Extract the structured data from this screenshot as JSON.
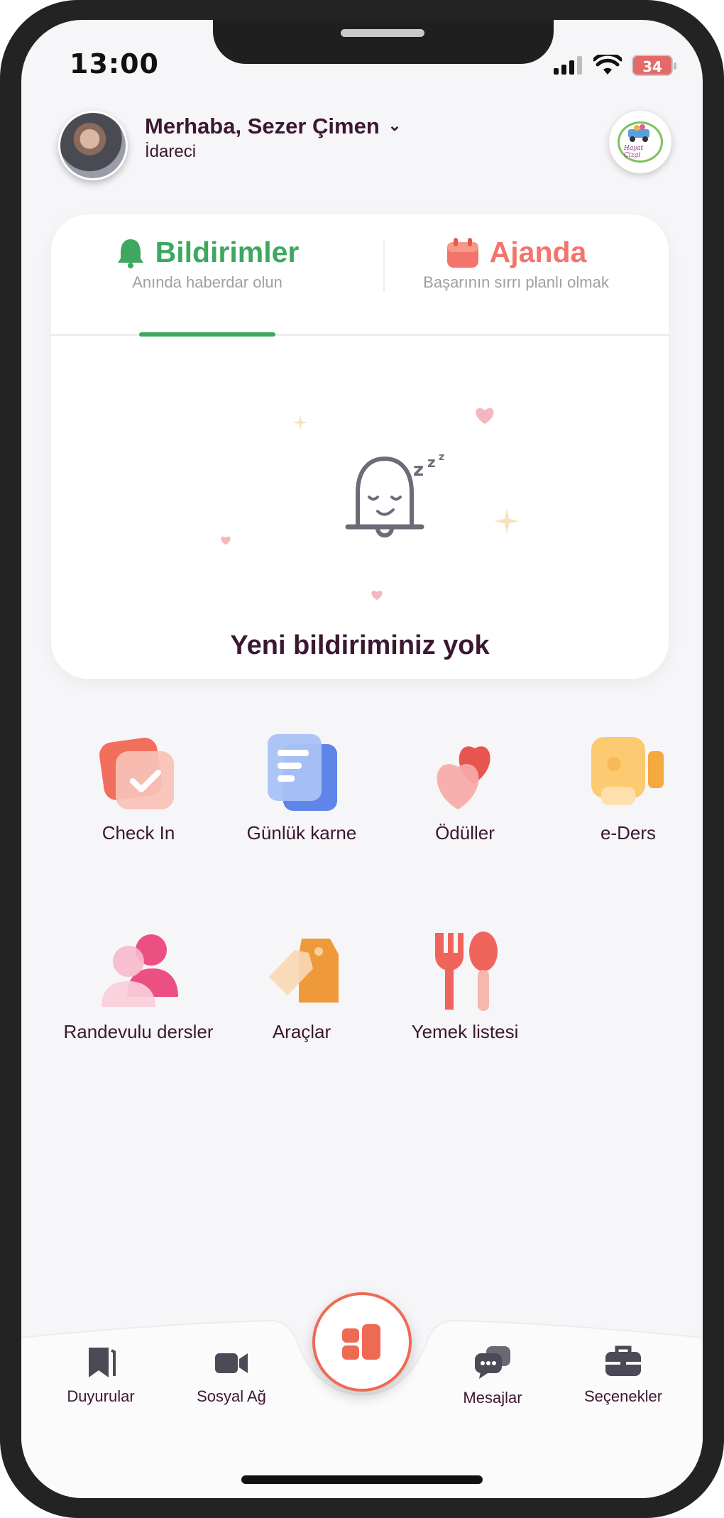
{
  "status_bar": {
    "time": "13:00",
    "battery": "34"
  },
  "header": {
    "greeting": "Merhaba, Sezer Çimen",
    "role": "İdareci",
    "school_logo_text": "Hayat Çizgi"
  },
  "tabs": [
    {
      "title": "Bildirimler",
      "subtitle": "Anında haberdar olun",
      "active": true,
      "color": "#3ea760"
    },
    {
      "title": "Ajanda",
      "subtitle": "Başarının sırrı planlı olmak",
      "active": false,
      "color": "#f2746b"
    }
  ],
  "empty_state": {
    "message": "Yeni bildiriminiz yok"
  },
  "menu": [
    {
      "label": "Check In",
      "icon": "check-in-icon"
    },
    {
      "label": "Günlük karne",
      "icon": "daily-report-icon"
    },
    {
      "label": "Ödüller",
      "icon": "hearts-icon"
    },
    {
      "label": "e-Ders",
      "icon": "video-camera-icon"
    },
    {
      "label": "Randevulu dersler",
      "icon": "people-icon"
    },
    {
      "label": "Araçlar",
      "icon": "tag-icon"
    },
    {
      "label": "Yemek listesi",
      "icon": "fork-spoon-icon"
    }
  ],
  "bottom_nav": [
    {
      "label": "Duyurular",
      "icon": "bookmark-icon"
    },
    {
      "label": "Sosyal Ağ",
      "icon": "video-icon"
    },
    {
      "label": "Mesajlar",
      "icon": "chat-icon"
    },
    {
      "label": "Seçenekler",
      "icon": "briefcase-icon"
    }
  ],
  "colors": {
    "accent": "#ef6a55",
    "text": "#3b1832",
    "green": "#3ea760"
  }
}
